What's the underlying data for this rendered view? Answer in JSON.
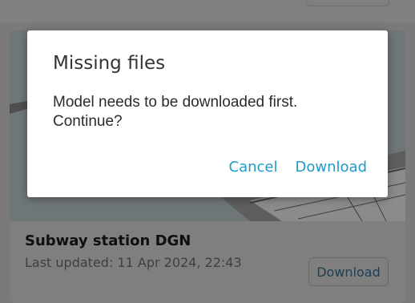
{
  "card": {
    "title": "Subway station DGN",
    "last_updated": "Last updated: 11 Apr 2024, 22:43",
    "download_label": "Download"
  },
  "dialog": {
    "title": "Missing files",
    "message": "Model needs to be downloaded first. Continue?",
    "cancel_label": "Cancel",
    "download_label": "Download"
  },
  "colors": {
    "accent": "#1f9ac9",
    "overlay": "#7a7a7a",
    "dialog_bg": "#ffffff"
  }
}
